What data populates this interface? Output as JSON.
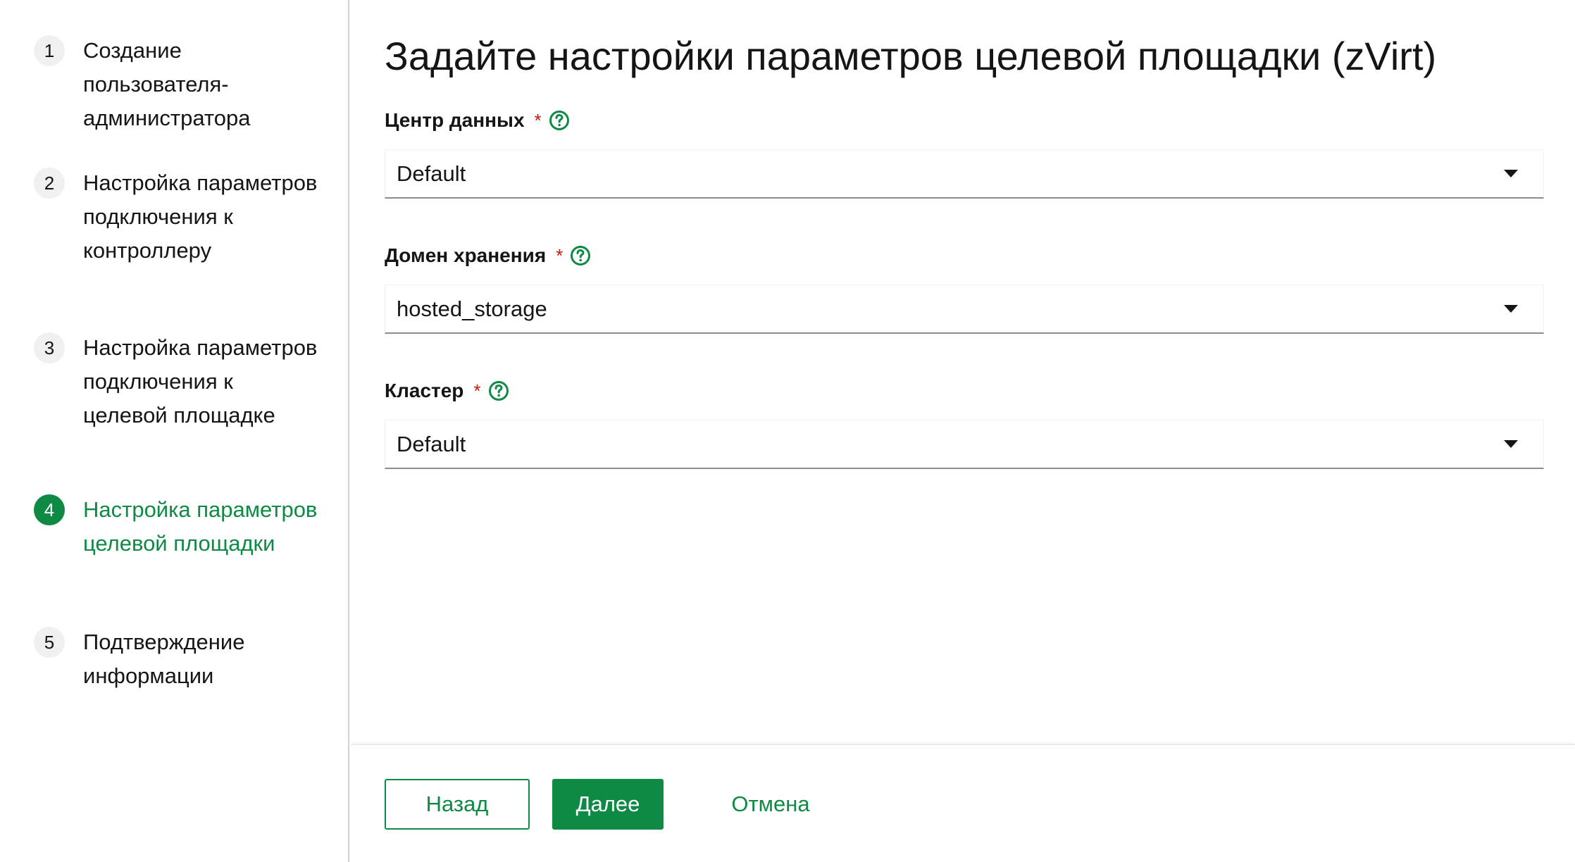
{
  "wizard": {
    "steps": [
      {
        "number": "1",
        "label": "Создание пользователя-администратора"
      },
      {
        "number": "2",
        "label": "Настройка параметров подключения к контроллеру"
      },
      {
        "number": "3",
        "label": "Настройка параметров подключения к целевой площадке"
      },
      {
        "number": "4",
        "label": "Настройка параметров целевой площадки"
      },
      {
        "number": "5",
        "label": "Подтверждение информации"
      }
    ],
    "active_step": "4"
  },
  "main": {
    "title": "Задайте настройки параметров целевой площадки (zVirt)",
    "fields": [
      {
        "label": "Центр данных",
        "required_mark": "*",
        "value": "Default"
      },
      {
        "label": "Домен хранения",
        "required_mark": "*",
        "value": "hosted_storage"
      },
      {
        "label": "Кластер",
        "required_mark": "*",
        "value": "Default"
      }
    ]
  },
  "footer": {
    "back_label": "Назад",
    "next_label": "Далее",
    "cancel_label": "Отмена"
  },
  "colors": {
    "accent": "#0e8a45",
    "required": "#c9190b",
    "text": "#151515"
  },
  "icons": {
    "help": "help-circle-icon",
    "dropdown": "caret-down-icon"
  }
}
